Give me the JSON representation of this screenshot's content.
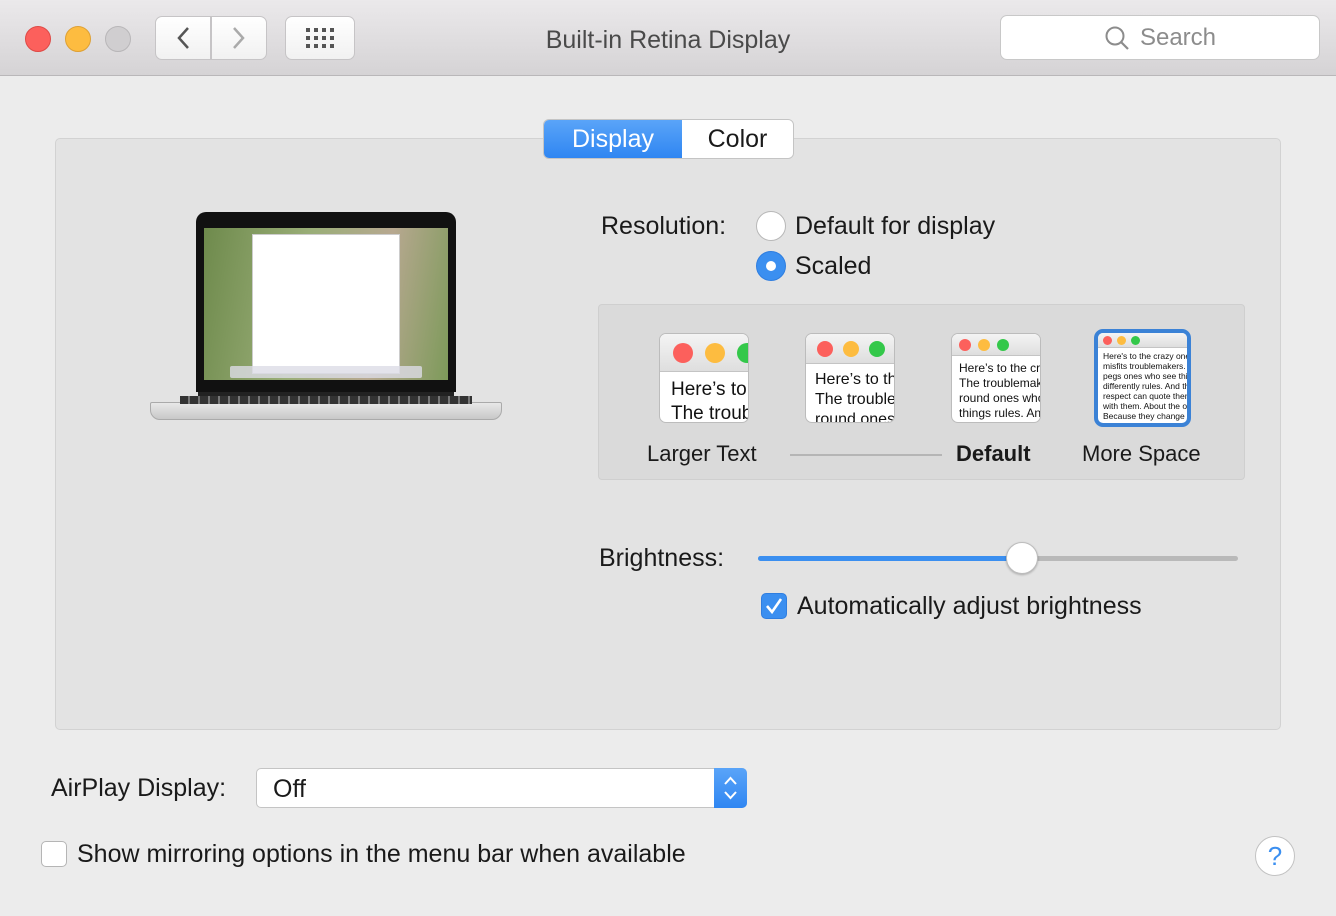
{
  "window": {
    "title": "Built-in Retina Display",
    "search_placeholder": "Search"
  },
  "tabs": [
    {
      "label": "Display",
      "selected": true
    },
    {
      "label": "Color",
      "selected": false
    }
  ],
  "resolution": {
    "label": "Resolution:",
    "options": [
      {
        "label": "Default for display",
        "selected": false
      },
      {
        "label": "Scaled",
        "selected": true
      }
    ]
  },
  "scaled_options": [
    {
      "label": "Larger Text",
      "preview": "Here’s to the crazy ones. The troublemakers",
      "selected": false
    },
    {
      "label": "",
      "preview": "Here’s to the crazy ones. The troublemakers. The round ones who see",
      "selected": false
    },
    {
      "label": "Default",
      "preview": "Here’s to the crazy ones. The troublemakers. The round ones who see things rules. And they",
      "selected": false
    },
    {
      "label": "More Space",
      "preview": "Here's to the crazy ones. The misfits troublemakers. The round pegs ones who see things differently rules. And they have no respect can quote them, disagree with them. About the only thing Because they change things",
      "selected": true
    }
  ],
  "brightness": {
    "label": "Brightness:",
    "value": 0.55,
    "auto_label": "Automatically adjust brightness",
    "auto_checked": true
  },
  "airplay": {
    "label": "AirPlay Display:",
    "value": "Off"
  },
  "mirroring": {
    "label": "Show mirroring options in the menu bar when available",
    "checked": false
  },
  "help_label": "?",
  "colors": {
    "accent": "#3b8ff0",
    "close": "#fc605c",
    "minimize": "#fdbc40",
    "zoom": "#34c84a"
  }
}
